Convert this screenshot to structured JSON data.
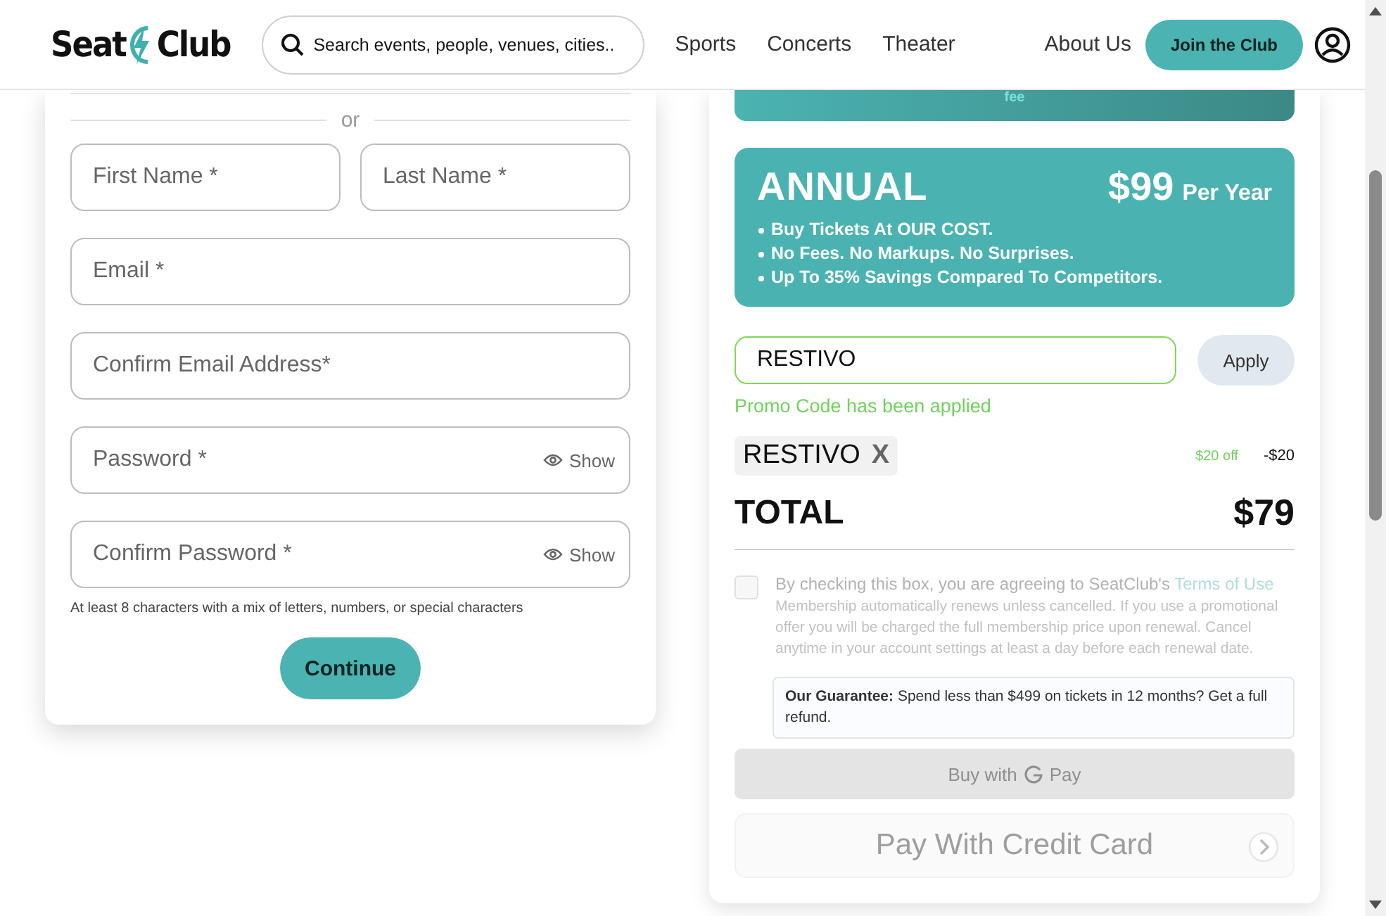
{
  "header": {
    "logo": {
      "left": "Seat",
      "right": "Club"
    },
    "search": {
      "placeholder": "Search events, people, venues, cities.."
    },
    "nav": [
      "Sports",
      "Concerts",
      "Theater"
    ],
    "about": "About Us",
    "join": "Join the Club"
  },
  "signup": {
    "divider": "or",
    "fields": [
      {
        "kind": "text",
        "placeholder": "First Name *"
      },
      {
        "kind": "text",
        "placeholder": "Last Name *"
      },
      {
        "kind": "text",
        "placeholder": "Email *"
      },
      {
        "kind": "text",
        "placeholder": "Confirm Email Address*"
      },
      {
        "kind": "password",
        "placeholder": "Password *",
        "toggle": "Show"
      },
      {
        "kind": "password",
        "placeholder": "Confirm Password *",
        "toggle": "Show"
      }
    ],
    "hint": "At least 8 characters with a mix of letters, numbers, or special characters",
    "button": "Continue"
  },
  "checkout": {
    "top_plan": {
      "text": "fee"
    },
    "plan": {
      "name": "ANNUAL",
      "price": "$99",
      "period": "Per Year",
      "features": [
        "Buy Tickets At OUR COST.",
        "No Fees. No Markups. No Surprises.",
        "Up To 35% Savings Compared To Competitors."
      ]
    },
    "promo": {
      "value": "RESTIVO",
      "button": "Apply",
      "valid": true,
      "message": "Promo Code has been applied"
    },
    "applied": {
      "code": "RESTIVO",
      "remove": "X",
      "discount": "$20 off",
      "amount": "-$20"
    },
    "total": {
      "label": "TOTAL",
      "amount": "$79"
    },
    "terms": {
      "checked": false,
      "text": "By checking this box, you are agreeing to SeatClub's",
      "link": "Terms of Use",
      "note": "Membership automatically renews unless cancelled. If you use a promotional offer you will be charged the full membership price upon renewal. Cancel anytime in your account settings at least a day before each renewal date."
    },
    "guarantee": "**Our Guarantee:** Spend less than $499 on tickets in 12 months? Get a full refund.",
    "gpay": {
      "label": "Buy with",
      "brand": "Pay",
      "disabled": true
    },
    "card_pay": {
      "label": "Pay With Credit Card",
      "disabled": true
    }
  }
}
